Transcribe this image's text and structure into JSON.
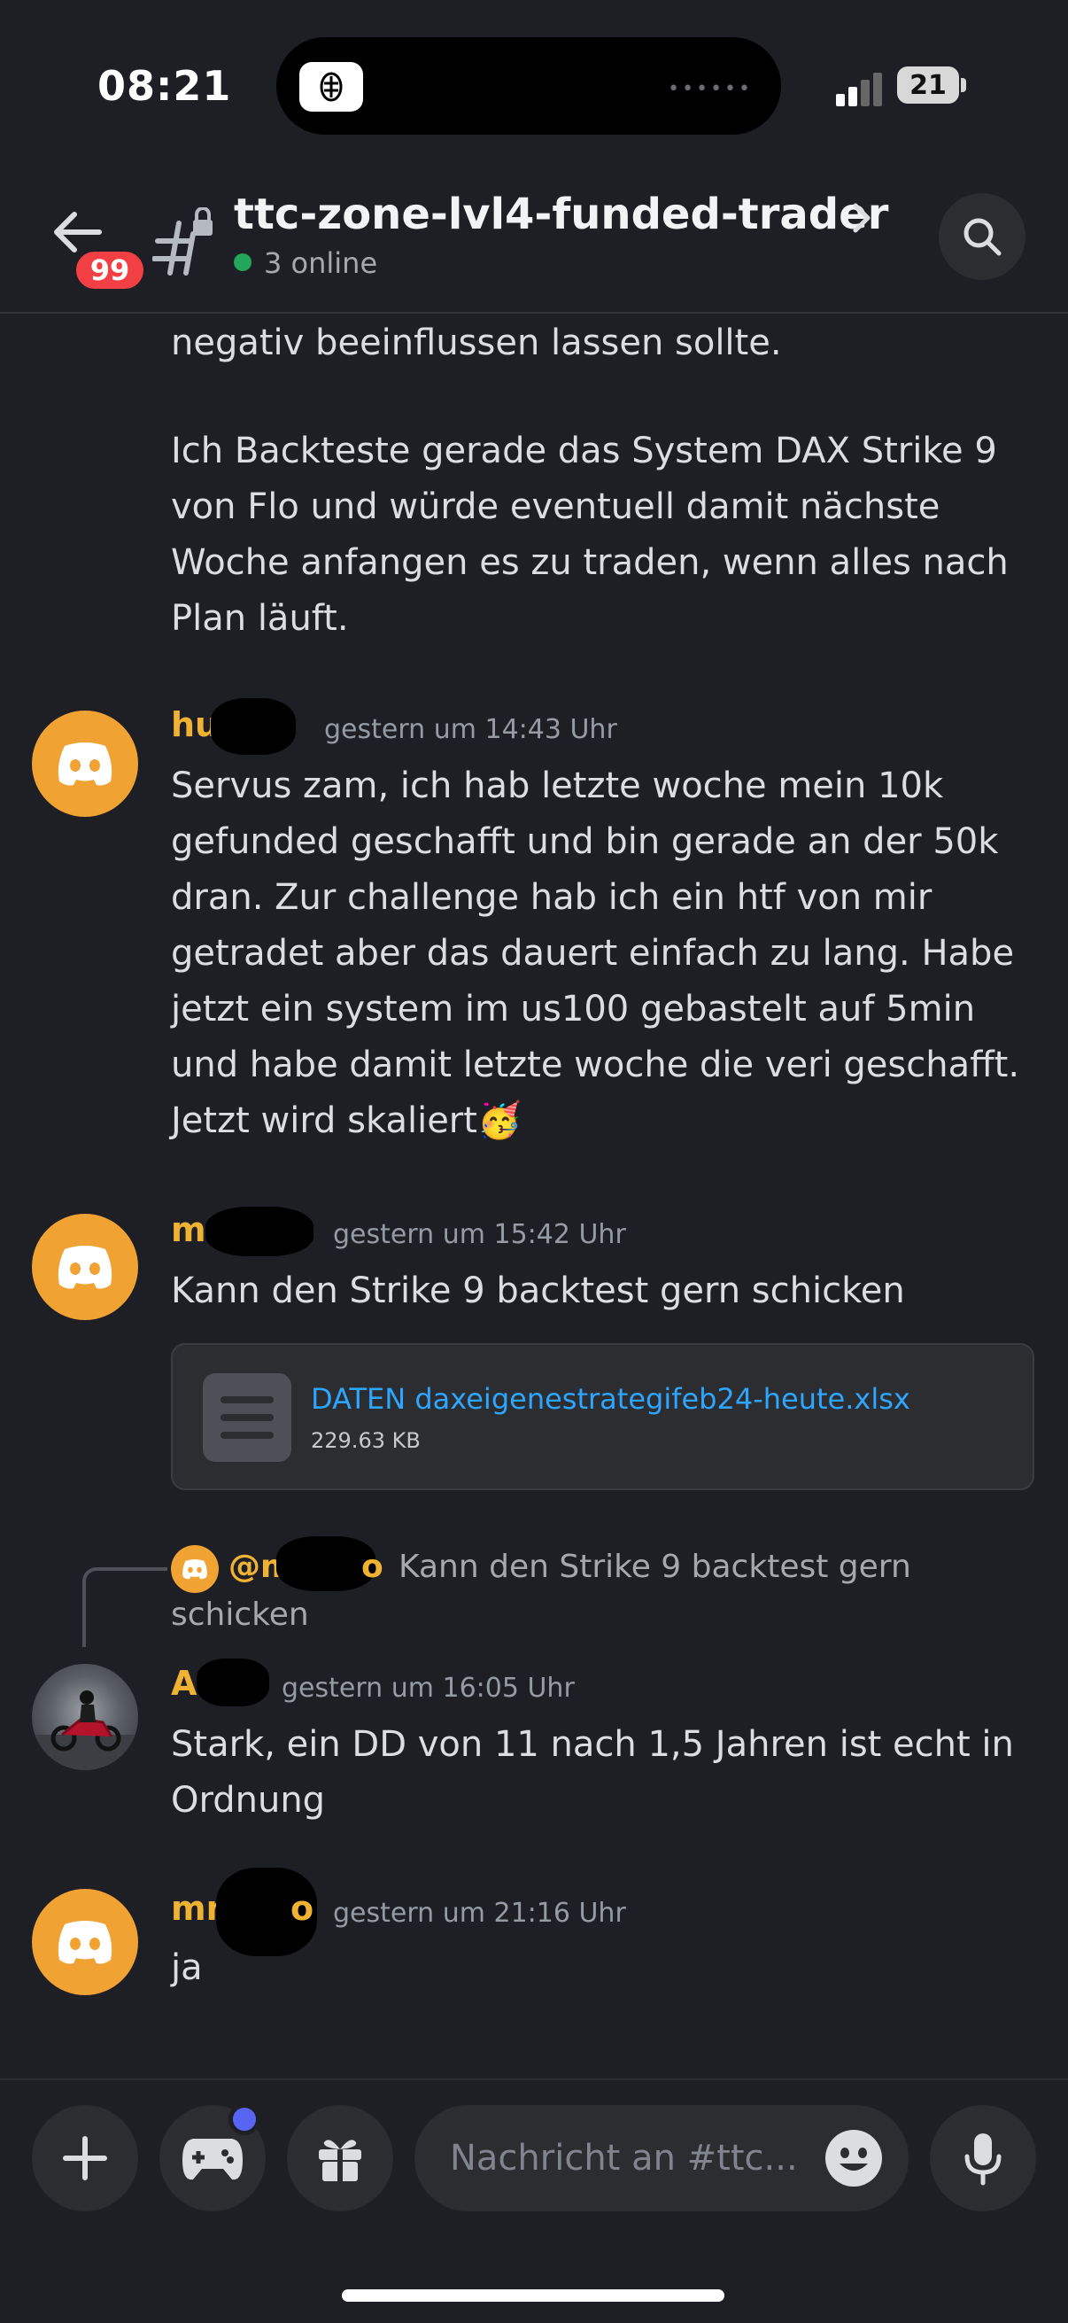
{
  "status_bar": {
    "time": "08:21",
    "battery": "21"
  },
  "header": {
    "badge_count": "99",
    "channel_name": "ttc-zone-lvl4-funded-trader",
    "online_text": "3 online",
    "search_icon": "search-icon"
  },
  "messages": {
    "m0": {
      "line1": "negativ beeinflussen lassen sollte.",
      "line2": "Ich Backteste gerade das System DAX Strike 9",
      "line3": "von Flo und würde eventuell damit nächste",
      "line4": "Woche anfangen es zu traden, wenn alles nach",
      "line5": "Plan läuft."
    },
    "m1": {
      "username": "hu        1",
      "timestamp": "gestern um 14:43 Uhr",
      "line1": "Servus zam, ich hab letzte woche mein 10k",
      "line2": "gefunded geschafft und bin gerade an der 50k",
      "line3": "dran. Zur challenge hab ich ein htf von mir",
      "line4": "getradet aber das dauert einfach zu lang. Habe",
      "line5": "jetzt ein system im us100 gebastelt auf 5min",
      "line6": "und habe damit letzte woche die veri geschafft.",
      "line7": "Jetzt wird skaliert",
      "emoji": "🥳"
    },
    "m2": {
      "username": "mm",
      "timestamp": "gestern um 15:42 Uhr",
      "text": "Kann den Strike 9 backtest gern schicken",
      "attachment_name": "DATEN daxeigenestrategifeb24-heute.xlsx",
      "attachment_size": "229.63 KB"
    },
    "m3": {
      "reply_user": "@m",
      "reply_user_end": "o",
      "reply_text": "Kann den Strike 9 backtest gern",
      "reply_text2": "schicken",
      "username": "A",
      "timestamp": "gestern um 16:05 Uhr",
      "line1": "Stark, ein DD von 11 nach 1,5 Jahren ist echt in",
      "line2": "Ordnung"
    },
    "m4": {
      "username": "mn",
      "username_end": "o",
      "timestamp": "gestern um 21:16 Uhr",
      "text": "ja"
    }
  },
  "input": {
    "placeholder": "Nachricht an #ttc..."
  },
  "colors": {
    "accent": "#5865f2",
    "username": "#f0b232",
    "link": "#2ea5ff",
    "online": "#23a55a",
    "badge": "#f23f43"
  }
}
